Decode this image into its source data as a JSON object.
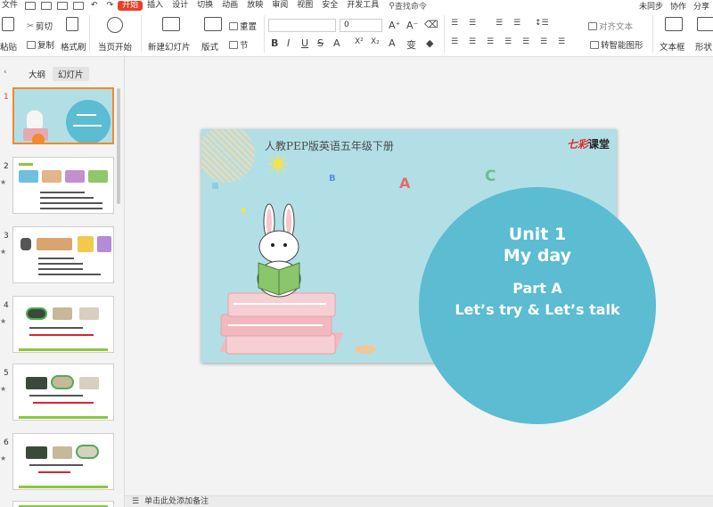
{
  "menubar": {
    "file": "文件",
    "tabs": [
      "开始",
      "插入",
      "设计",
      "切换",
      "动画",
      "放映",
      "审阅",
      "视图",
      "安全",
      "开发工具"
    ],
    "search": "查找命令",
    "sync": "未同步",
    "collab": "协作",
    "share": "分享"
  },
  "ribbon": {
    "paste": "粘贴",
    "cut": "剪切",
    "copy": "复制",
    "format_painter": "格式刷",
    "from_start": "当页开始",
    "new_slide": "新建幻灯片",
    "layout": "版式",
    "reset": "重置",
    "section": "节",
    "font_size": "0",
    "align_text": "对齐文本",
    "smart_art": "转智能图形",
    "text_box": "文本框",
    "shape": "形状"
  },
  "panel": {
    "tabs": [
      "大纲",
      "幻灯片"
    ],
    "slide_numbers": [
      "1",
      "2",
      "3",
      "4",
      "5",
      "6"
    ]
  },
  "slide": {
    "title": "人教PEP版英语五年级下册",
    "logo_text": "七彩",
    "logo_suffix": "课堂",
    "unit": "Unit 1",
    "name": "My day",
    "part": "Part A",
    "section": "Let’s try & Let’s talk"
  },
  "notes": {
    "placeholder": "单击此处添加备注"
  }
}
